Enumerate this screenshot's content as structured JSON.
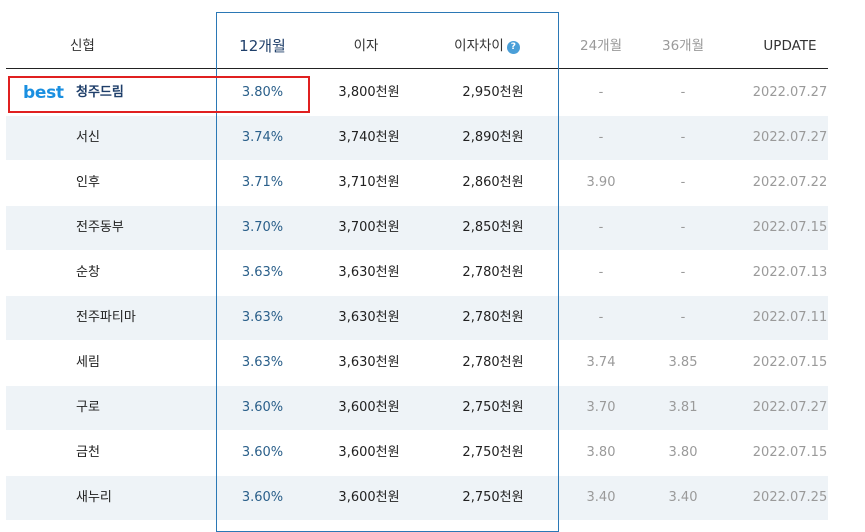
{
  "headers": {
    "name": "신협",
    "rate12": "12개월",
    "interest": "이자",
    "diff": "이자차이",
    "help_icon": "question-icon",
    "rate24": "24개월",
    "rate36": "36개월",
    "update": "UPDATE"
  },
  "best_label": "best",
  "colors": {
    "accent": "#2b78b5",
    "best": "#1a8fe0",
    "highlight_box": "#e02020",
    "alt_row": "#eef3f7"
  },
  "rows": [
    {
      "name": "청주드림",
      "rate12": "3.80%",
      "interest": "3,800천원",
      "diff": "2,950천원",
      "rate24": "-",
      "rate36": "-",
      "update": "2022.07.27"
    },
    {
      "name": "서신",
      "rate12": "3.74%",
      "interest": "3,740천원",
      "diff": "2,890천원",
      "rate24": "-",
      "rate36": "-",
      "update": "2022.07.27"
    },
    {
      "name": "인후",
      "rate12": "3.71%",
      "interest": "3,710천원",
      "diff": "2,860천원",
      "rate24": "3.90",
      "rate36": "-",
      "update": "2022.07.22"
    },
    {
      "name": "전주동부",
      "rate12": "3.70%",
      "interest": "3,700천원",
      "diff": "2,850천원",
      "rate24": "-",
      "rate36": "-",
      "update": "2022.07.15"
    },
    {
      "name": "순창",
      "rate12": "3.63%",
      "interest": "3,630천원",
      "diff": "2,780천원",
      "rate24": "-",
      "rate36": "-",
      "update": "2022.07.13"
    },
    {
      "name": "전주파티마",
      "rate12": "3.63%",
      "interest": "3,630천원",
      "diff": "2,780천원",
      "rate24": "-",
      "rate36": "-",
      "update": "2022.07.11"
    },
    {
      "name": "세림",
      "rate12": "3.63%",
      "interest": "3,630천원",
      "diff": "2,780천원",
      "rate24": "3.74",
      "rate36": "3.85",
      "update": "2022.07.15"
    },
    {
      "name": "구로",
      "rate12": "3.60%",
      "interest": "3,600천원",
      "diff": "2,750천원",
      "rate24": "3.70",
      "rate36": "3.81",
      "update": "2022.07.27"
    },
    {
      "name": "금천",
      "rate12": "3.60%",
      "interest": "3,600천원",
      "diff": "2,750천원",
      "rate24": "3.80",
      "rate36": "3.80",
      "update": "2022.07.15"
    },
    {
      "name": "새누리",
      "rate12": "3.60%",
      "interest": "3,600천원",
      "diff": "2,750천원",
      "rate24": "3.40",
      "rate36": "3.40",
      "update": "2022.07.25"
    }
  ]
}
